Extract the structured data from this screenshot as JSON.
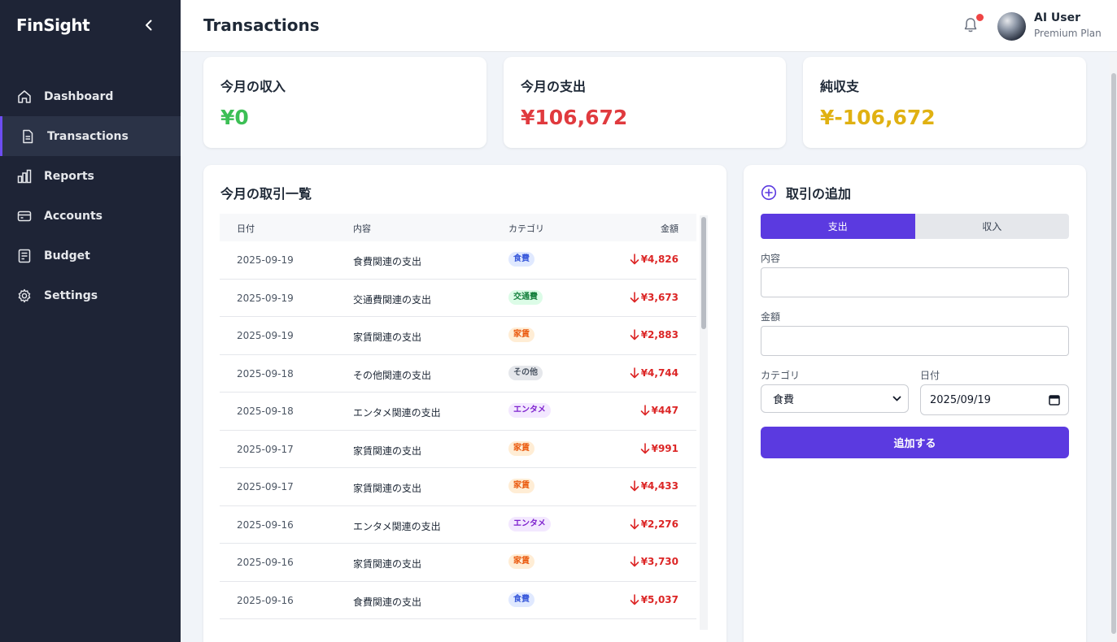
{
  "app": {
    "brand": "FinSight"
  },
  "sidebar": {
    "items": [
      {
        "label": "Dashboard",
        "icon": "home-icon",
        "active": false
      },
      {
        "label": "Transactions",
        "icon": "document-icon",
        "active": true
      },
      {
        "label": "Reports",
        "icon": "bar-chart-icon",
        "active": false
      },
      {
        "label": "Accounts",
        "icon": "credit-card-icon",
        "active": false
      },
      {
        "label": "Budget",
        "icon": "ledger-icon",
        "active": false
      },
      {
        "label": "Settings",
        "icon": "gear-icon",
        "active": false
      }
    ]
  },
  "header": {
    "title": "Transactions",
    "user_name": "AI User",
    "user_plan": "Premium Plan"
  },
  "stats": {
    "income_label": "今月の収入",
    "income_value": "¥0",
    "expense_label": "今月の支出",
    "expense_value": "¥106,672",
    "net_label": "純収支",
    "net_value": "¥-106,672"
  },
  "transactions": {
    "title": "今月の取引一覧",
    "columns": [
      "日付",
      "内容",
      "カテゴリ",
      "金額"
    ],
    "rows": [
      {
        "date": "2025-09-19",
        "desc": "食費関連の支出",
        "category": "食費",
        "amount": "¥4,826"
      },
      {
        "date": "2025-09-19",
        "desc": "交通費関連の支出",
        "category": "交通費",
        "amount": "¥3,673"
      },
      {
        "date": "2025-09-19",
        "desc": "家賃関連の支出",
        "category": "家賃",
        "amount": "¥2,883"
      },
      {
        "date": "2025-09-18",
        "desc": "その他関連の支出",
        "category": "その他",
        "amount": "¥4,744"
      },
      {
        "date": "2025-09-18",
        "desc": "エンタメ関連の支出",
        "category": "エンタメ",
        "amount": "¥447"
      },
      {
        "date": "2025-09-17",
        "desc": "家賃関連の支出",
        "category": "家賃",
        "amount": "¥991"
      },
      {
        "date": "2025-09-17",
        "desc": "家賃関連の支出",
        "category": "家賃",
        "amount": "¥4,433"
      },
      {
        "date": "2025-09-16",
        "desc": "エンタメ関連の支出",
        "category": "エンタメ",
        "amount": "¥2,276"
      },
      {
        "date": "2025-09-16",
        "desc": "家賃関連の支出",
        "category": "家賃",
        "amount": "¥3,730"
      },
      {
        "date": "2025-09-16",
        "desc": "食費関連の支出",
        "category": "食費",
        "amount": "¥5,037"
      }
    ]
  },
  "category_colors": {
    "食費": {
      "bg": "#e0e9ff",
      "fg": "#3b5bdb"
    },
    "交通費": {
      "bg": "#dcfce7",
      "fg": "#15803d"
    },
    "家賃": {
      "bg": "#ffedd5",
      "fg": "#ea580c"
    },
    "その他": {
      "bg": "#e5e7eb",
      "fg": "#4b5563"
    },
    "エンタメ": {
      "bg": "#f3e8ff",
      "fg": "#7e22ce"
    }
  },
  "form": {
    "title": "取引の追加",
    "type_expense": "支出",
    "type_income": "収入",
    "content_label": "内容",
    "amount_label": "金額",
    "category_label": "カテゴリ",
    "category_value": "食費",
    "date_label": "日付",
    "date_value": "2025/09/19",
    "submit_label": "追加する"
  },
  "colors": {
    "accent": "#5b3ae0",
    "income": "#22c55e",
    "expense": "#e03131",
    "net": "#e0b210"
  }
}
